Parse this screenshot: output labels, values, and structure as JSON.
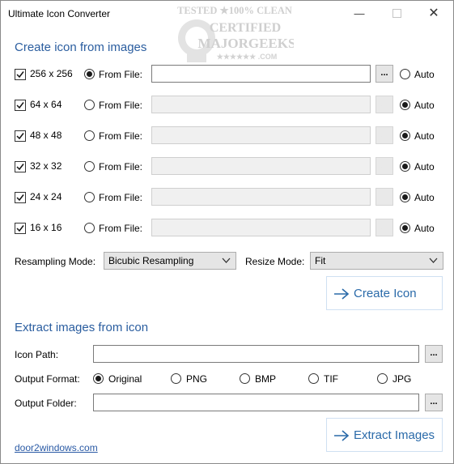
{
  "window": {
    "title": "Ultimate Icon Converter"
  },
  "watermark": {
    "line1": "TESTED ★100% CLEAN",
    "line2": "CERTIFIED",
    "line3": "MAJORGEEKS",
    "line4": "★★★★★★ .COM"
  },
  "create_section": {
    "title": "Create icon from images",
    "rows": [
      {
        "size": "256 x 256",
        "checked": true,
        "mode": "file",
        "from_file_label": "From File:",
        "path": "",
        "auto_label": "Auto"
      },
      {
        "size": "64 x 64",
        "checked": true,
        "mode": "auto",
        "from_file_label": "From File:",
        "path": "",
        "auto_label": "Auto"
      },
      {
        "size": "48 x 48",
        "checked": true,
        "mode": "auto",
        "from_file_label": "From File:",
        "path": "",
        "auto_label": "Auto"
      },
      {
        "size": "32 x 32",
        "checked": true,
        "mode": "auto",
        "from_file_label": "From File:",
        "path": "",
        "auto_label": "Auto"
      },
      {
        "size": "24 x 24",
        "checked": true,
        "mode": "auto",
        "from_file_label": "From File:",
        "path": "",
        "auto_label": "Auto"
      },
      {
        "size": "16 x 16",
        "checked": true,
        "mode": "auto",
        "from_file_label": "From File:",
        "path": "",
        "auto_label": "Auto"
      }
    ],
    "browse_label": "...",
    "resampling_label": "Resampling Mode:",
    "resampling_value": "Bicubic Resampling",
    "resize_label": "Resize Mode:",
    "resize_value": "Fit",
    "create_button": "Create Icon"
  },
  "extract_section": {
    "title": "Extract images from icon",
    "icon_path_label": "Icon Path:",
    "icon_path_value": "",
    "output_format_label": "Output Format:",
    "formats": [
      {
        "label": "Original",
        "selected": true
      },
      {
        "label": "PNG",
        "selected": false
      },
      {
        "label": "BMP",
        "selected": false
      },
      {
        "label": "TIF",
        "selected": false
      },
      {
        "label": "JPG",
        "selected": false
      }
    ],
    "output_folder_label": "Output Folder:",
    "output_folder_value": "",
    "browse_label": "...",
    "extract_button": "Extract Images"
  },
  "footer_link": "door2windows.com",
  "colors": {
    "accent": "#2a5d9f",
    "button_text": "#2a6aa9"
  }
}
